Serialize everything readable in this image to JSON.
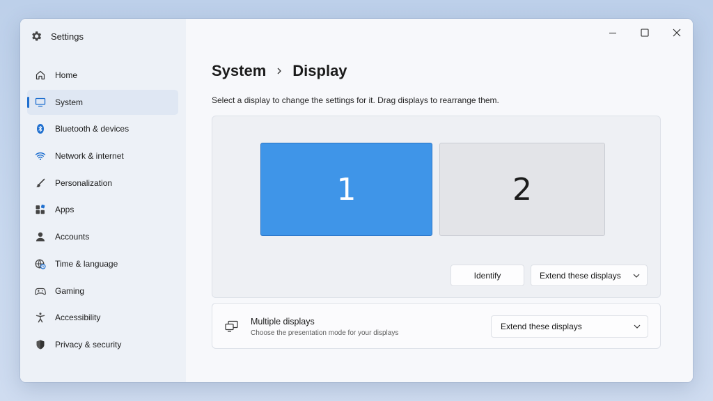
{
  "window": {
    "title": "Settings"
  },
  "sidebar": {
    "items": [
      {
        "label": "Home",
        "icon": "home-icon"
      },
      {
        "label": "System",
        "icon": "monitor-icon",
        "active": true
      },
      {
        "label": "Bluetooth & devices",
        "icon": "bluetooth-icon"
      },
      {
        "label": "Network & internet",
        "icon": "wifi-icon"
      },
      {
        "label": "Personalization",
        "icon": "brush-icon"
      },
      {
        "label": "Apps",
        "icon": "apps-icon"
      },
      {
        "label": "Accounts",
        "icon": "person-icon"
      },
      {
        "label": "Time & language",
        "icon": "globe-clock-icon"
      },
      {
        "label": "Gaming",
        "icon": "gamepad-icon"
      },
      {
        "label": "Accessibility",
        "icon": "accessibility-icon"
      },
      {
        "label": "Privacy & security",
        "icon": "shield-icon"
      }
    ]
  },
  "breadcrumb": {
    "parent": "System",
    "current": "Display"
  },
  "description": "Select a display to change the settings for it. Drag displays to rearrange them.",
  "arrangement": {
    "monitors": [
      {
        "number": "1",
        "selected": true
      },
      {
        "number": "2",
        "selected": false
      }
    ],
    "identify_label": "Identify",
    "mode_selected": "Extend these displays"
  },
  "multiple_displays": {
    "title": "Multiple displays",
    "subtitle": "Choose the presentation mode for your displays",
    "mode_selected": "Extend these displays"
  },
  "colors": {
    "accent": "#1f6fcf",
    "selected_monitor": "#3f95e8"
  }
}
